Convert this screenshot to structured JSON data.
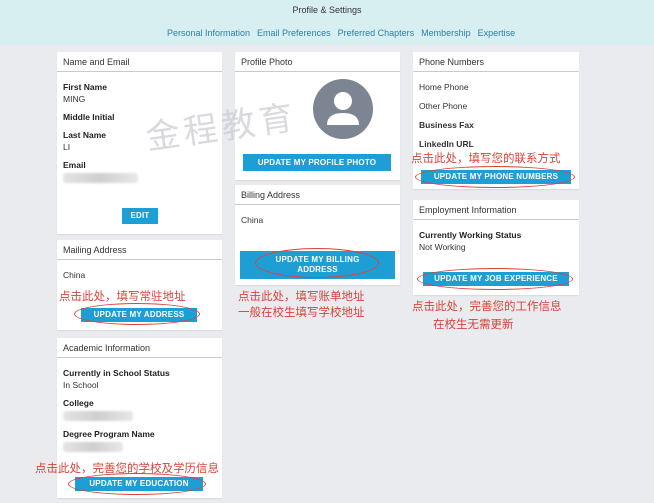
{
  "header": {
    "title": "Profile & Settings",
    "tabs": [
      "Personal Information",
      "Email Preferences",
      "Preferred Chapters",
      "Membership",
      "Expertise"
    ]
  },
  "watermark": "金程教育",
  "name_email": {
    "title": "Name and Email",
    "first_name_label": "First Name",
    "first_name": "MING",
    "middle_initial_label": "Middle Initial",
    "last_name_label": "Last Name",
    "last_name": "LI",
    "email_label": "Email",
    "edit_label": "EDIT"
  },
  "mailing": {
    "title": "Mailing Address",
    "country": "China",
    "button_label": "UPDATE MY ADDRESS"
  },
  "academic": {
    "title": "Academic Information",
    "status_label": "Currently in School Status",
    "status_value": "In School",
    "college_label": "College",
    "degree_label": "Degree Program Name",
    "button_label": "UPDATE MY EDUCATION"
  },
  "photo": {
    "title": "Profile Photo",
    "button_label": "UPDATE MY PROFILE PHOTO"
  },
  "billing": {
    "title": "Billing Address",
    "country": "China",
    "button_line1": "UPDATE MY BILLING",
    "button_line2": "ADDRESS"
  },
  "phone": {
    "title": "Phone Numbers",
    "home_label": "Home Phone",
    "other_label": "Other Phone",
    "fax_label": "Business Fax",
    "linkedin_label": "LinkedIn URL",
    "button_label": "UPDATE MY PHONE NUMBERS"
  },
  "employment": {
    "title": "Employment Information",
    "status_label": "Currently Working Status",
    "status_value": "Not Working",
    "button_label": "UPDATE MY JOB EXPERIENCE"
  },
  "annotations": {
    "address": "点击此处，填写常驻地址",
    "billing_line1": "点击此处，填写账单地址",
    "billing_line2": "一般在校生填写学校地址",
    "phone": "点击此处，填写您的联系方式",
    "job_line1": "点击此处，完善您的工作信息",
    "job_line2": "在校生无需更新",
    "education": "点击此处，完善您的学校及学历信息"
  },
  "colors": {
    "button": "#1d9fd6",
    "annotation": "#d9433a",
    "link": "#2a7fa8",
    "header": "#d8eff1"
  }
}
